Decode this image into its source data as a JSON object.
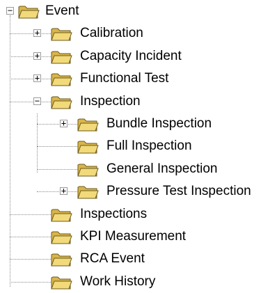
{
  "tree": {
    "nodes": [
      {
        "label": "Event",
        "level": 0,
        "toggle": "−",
        "icon": "folder-icon"
      },
      {
        "label": "Calibration",
        "level": 1,
        "toggle": "+",
        "icon": "folder-icon"
      },
      {
        "label": "Capacity Incident",
        "level": 1,
        "toggle": "+",
        "icon": "folder-icon"
      },
      {
        "label": "Functional Test",
        "level": 1,
        "toggle": "+",
        "icon": "folder-icon"
      },
      {
        "label": "Inspection",
        "level": 1,
        "toggle": "−",
        "icon": "folder-icon"
      },
      {
        "label": "Bundle Inspection",
        "level": 2,
        "toggle": "+",
        "icon": "folder-icon"
      },
      {
        "label": "Full Inspection",
        "level": 2,
        "toggle": "",
        "icon": "folder-icon"
      },
      {
        "label": "General Inspection",
        "level": 2,
        "toggle": "",
        "icon": "folder-icon"
      },
      {
        "label": "Pressure Test Inspection",
        "level": 2,
        "toggle": "+",
        "icon": "folder-icon"
      },
      {
        "label": "Inspections",
        "level": 1,
        "toggle": "",
        "icon": "folder-icon"
      },
      {
        "label": "KPI Measurement",
        "level": 1,
        "toggle": "",
        "icon": "folder-icon"
      },
      {
        "label": "RCA Event",
        "level": 1,
        "toggle": "",
        "icon": "folder-icon"
      },
      {
        "label": "Work History",
        "level": 1,
        "toggle": "",
        "icon": "folder-icon"
      }
    ],
    "colors": {
      "folder_fill": "#f2d97a",
      "folder_shade": "#d9b54a",
      "folder_outline": "#6b5a1f",
      "connector": "#8a8a8a"
    }
  }
}
